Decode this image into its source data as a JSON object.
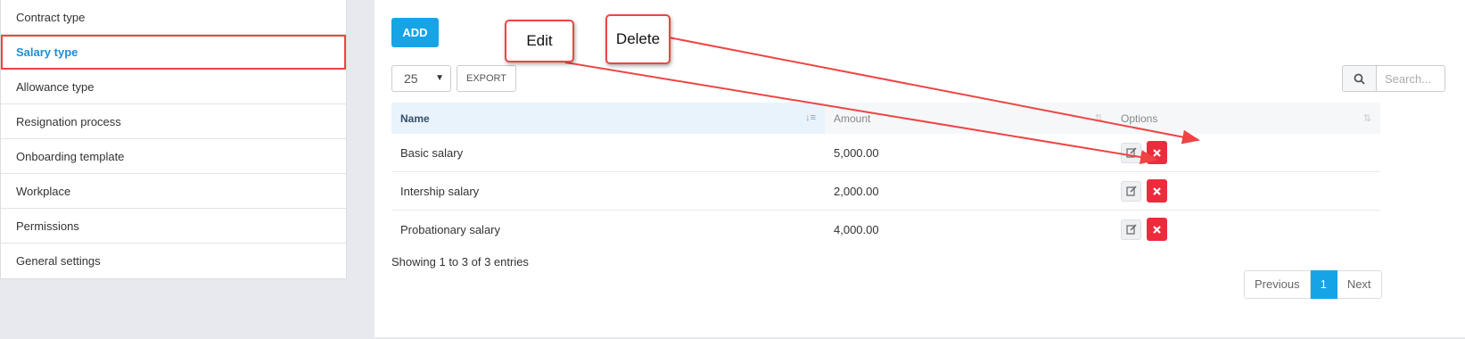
{
  "sidebar": {
    "items": [
      {
        "label": "Contract type"
      },
      {
        "label": "Salary type"
      },
      {
        "label": "Allowance type"
      },
      {
        "label": "Resignation process"
      },
      {
        "label": "Onboarding template"
      },
      {
        "label": "Workplace"
      },
      {
        "label": "Permissions"
      },
      {
        "label": "General settings"
      }
    ],
    "active": "Salary type"
  },
  "toolbar": {
    "add_label": "ADD",
    "page_size": "25",
    "export_label": "EXPORT",
    "search_placeholder": "Search...",
    "search_icon": "search-icon"
  },
  "table": {
    "columns": [
      "Name",
      "Amount",
      "Options"
    ],
    "rows": [
      {
        "name": "Basic salary",
        "amount": "5,000.00"
      },
      {
        "name": "Intership salary",
        "amount": "2,000.00"
      },
      {
        "name": "Probationary salary",
        "amount": "4,000.00"
      }
    ],
    "icons": {
      "edit": "edit-icon",
      "delete": "delete-x-icon"
    }
  },
  "footer": {
    "info": "Showing 1 to 3 of 3 entries",
    "pagination": {
      "previous": "Previous",
      "current": "1",
      "next": "Next"
    }
  },
  "annotations": {
    "edit": "Edit",
    "delete": "Delete"
  },
  "colors": {
    "accent": "#16a4e6",
    "danger": "#ee2b3d",
    "annotation": "#ef4444",
    "active_link": "#1a8fd6"
  }
}
